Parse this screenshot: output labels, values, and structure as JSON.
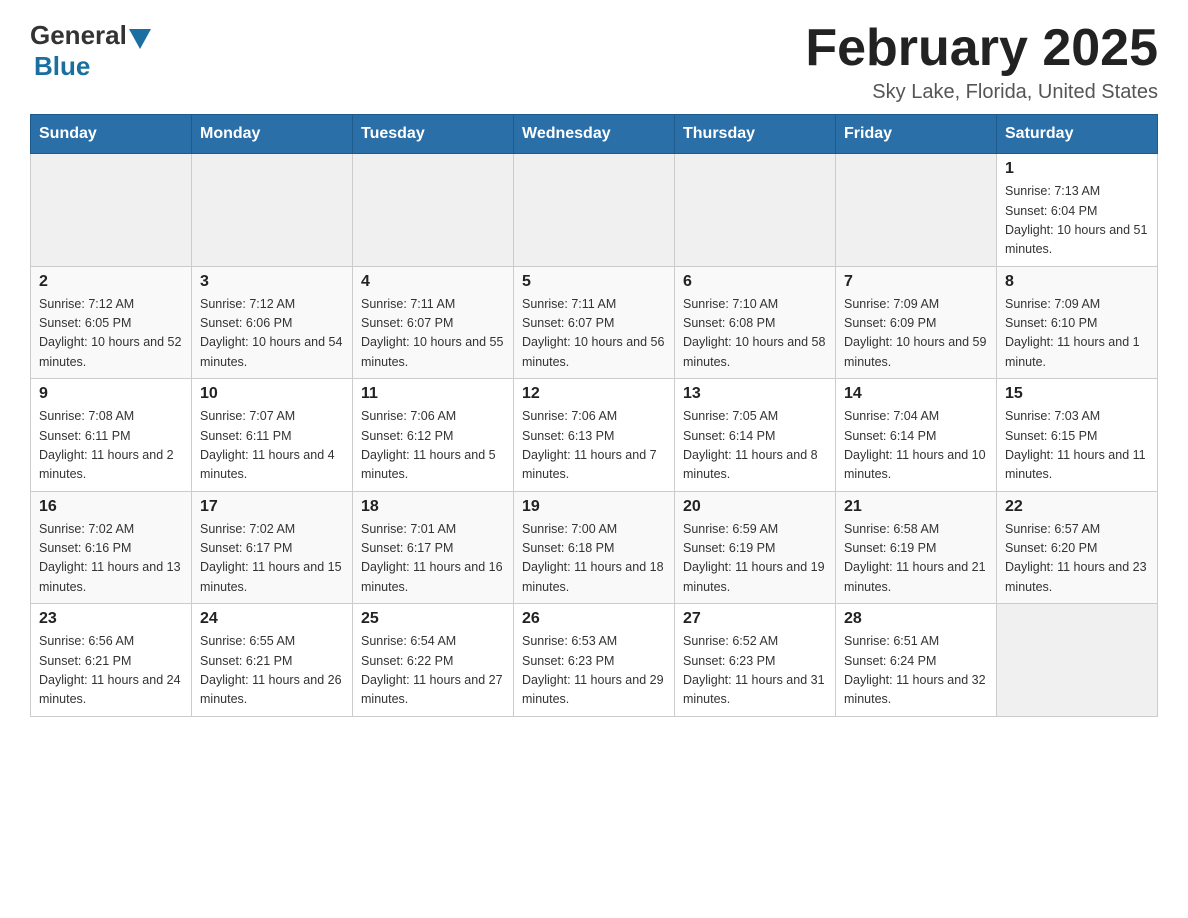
{
  "header": {
    "logo_general": "General",
    "logo_blue": "Blue",
    "title": "February 2025",
    "subtitle": "Sky Lake, Florida, United States"
  },
  "weekdays": [
    "Sunday",
    "Monday",
    "Tuesday",
    "Wednesday",
    "Thursday",
    "Friday",
    "Saturday"
  ],
  "weeks": [
    [
      {
        "day": "",
        "sunrise": "",
        "sunset": "",
        "daylight": ""
      },
      {
        "day": "",
        "sunrise": "",
        "sunset": "",
        "daylight": ""
      },
      {
        "day": "",
        "sunrise": "",
        "sunset": "",
        "daylight": ""
      },
      {
        "day": "",
        "sunrise": "",
        "sunset": "",
        "daylight": ""
      },
      {
        "day": "",
        "sunrise": "",
        "sunset": "",
        "daylight": ""
      },
      {
        "day": "",
        "sunrise": "",
        "sunset": "",
        "daylight": ""
      },
      {
        "day": "1",
        "sunrise": "Sunrise: 7:13 AM",
        "sunset": "Sunset: 6:04 PM",
        "daylight": "Daylight: 10 hours and 51 minutes."
      }
    ],
    [
      {
        "day": "2",
        "sunrise": "Sunrise: 7:12 AM",
        "sunset": "Sunset: 6:05 PM",
        "daylight": "Daylight: 10 hours and 52 minutes."
      },
      {
        "day": "3",
        "sunrise": "Sunrise: 7:12 AM",
        "sunset": "Sunset: 6:06 PM",
        "daylight": "Daylight: 10 hours and 54 minutes."
      },
      {
        "day": "4",
        "sunrise": "Sunrise: 7:11 AM",
        "sunset": "Sunset: 6:07 PM",
        "daylight": "Daylight: 10 hours and 55 minutes."
      },
      {
        "day": "5",
        "sunrise": "Sunrise: 7:11 AM",
        "sunset": "Sunset: 6:07 PM",
        "daylight": "Daylight: 10 hours and 56 minutes."
      },
      {
        "day": "6",
        "sunrise": "Sunrise: 7:10 AM",
        "sunset": "Sunset: 6:08 PM",
        "daylight": "Daylight: 10 hours and 58 minutes."
      },
      {
        "day": "7",
        "sunrise": "Sunrise: 7:09 AM",
        "sunset": "Sunset: 6:09 PM",
        "daylight": "Daylight: 10 hours and 59 minutes."
      },
      {
        "day": "8",
        "sunrise": "Sunrise: 7:09 AM",
        "sunset": "Sunset: 6:10 PM",
        "daylight": "Daylight: 11 hours and 1 minute."
      }
    ],
    [
      {
        "day": "9",
        "sunrise": "Sunrise: 7:08 AM",
        "sunset": "Sunset: 6:11 PM",
        "daylight": "Daylight: 11 hours and 2 minutes."
      },
      {
        "day": "10",
        "sunrise": "Sunrise: 7:07 AM",
        "sunset": "Sunset: 6:11 PM",
        "daylight": "Daylight: 11 hours and 4 minutes."
      },
      {
        "day": "11",
        "sunrise": "Sunrise: 7:06 AM",
        "sunset": "Sunset: 6:12 PM",
        "daylight": "Daylight: 11 hours and 5 minutes."
      },
      {
        "day": "12",
        "sunrise": "Sunrise: 7:06 AM",
        "sunset": "Sunset: 6:13 PM",
        "daylight": "Daylight: 11 hours and 7 minutes."
      },
      {
        "day": "13",
        "sunrise": "Sunrise: 7:05 AM",
        "sunset": "Sunset: 6:14 PM",
        "daylight": "Daylight: 11 hours and 8 minutes."
      },
      {
        "day": "14",
        "sunrise": "Sunrise: 7:04 AM",
        "sunset": "Sunset: 6:14 PM",
        "daylight": "Daylight: 11 hours and 10 minutes."
      },
      {
        "day": "15",
        "sunrise": "Sunrise: 7:03 AM",
        "sunset": "Sunset: 6:15 PM",
        "daylight": "Daylight: 11 hours and 11 minutes."
      }
    ],
    [
      {
        "day": "16",
        "sunrise": "Sunrise: 7:02 AM",
        "sunset": "Sunset: 6:16 PM",
        "daylight": "Daylight: 11 hours and 13 minutes."
      },
      {
        "day": "17",
        "sunrise": "Sunrise: 7:02 AM",
        "sunset": "Sunset: 6:17 PM",
        "daylight": "Daylight: 11 hours and 15 minutes."
      },
      {
        "day": "18",
        "sunrise": "Sunrise: 7:01 AM",
        "sunset": "Sunset: 6:17 PM",
        "daylight": "Daylight: 11 hours and 16 minutes."
      },
      {
        "day": "19",
        "sunrise": "Sunrise: 7:00 AM",
        "sunset": "Sunset: 6:18 PM",
        "daylight": "Daylight: 11 hours and 18 minutes."
      },
      {
        "day": "20",
        "sunrise": "Sunrise: 6:59 AM",
        "sunset": "Sunset: 6:19 PM",
        "daylight": "Daylight: 11 hours and 19 minutes."
      },
      {
        "day": "21",
        "sunrise": "Sunrise: 6:58 AM",
        "sunset": "Sunset: 6:19 PM",
        "daylight": "Daylight: 11 hours and 21 minutes."
      },
      {
        "day": "22",
        "sunrise": "Sunrise: 6:57 AM",
        "sunset": "Sunset: 6:20 PM",
        "daylight": "Daylight: 11 hours and 23 minutes."
      }
    ],
    [
      {
        "day": "23",
        "sunrise": "Sunrise: 6:56 AM",
        "sunset": "Sunset: 6:21 PM",
        "daylight": "Daylight: 11 hours and 24 minutes."
      },
      {
        "day": "24",
        "sunrise": "Sunrise: 6:55 AM",
        "sunset": "Sunset: 6:21 PM",
        "daylight": "Daylight: 11 hours and 26 minutes."
      },
      {
        "day": "25",
        "sunrise": "Sunrise: 6:54 AM",
        "sunset": "Sunset: 6:22 PM",
        "daylight": "Daylight: 11 hours and 27 minutes."
      },
      {
        "day": "26",
        "sunrise": "Sunrise: 6:53 AM",
        "sunset": "Sunset: 6:23 PM",
        "daylight": "Daylight: 11 hours and 29 minutes."
      },
      {
        "day": "27",
        "sunrise": "Sunrise: 6:52 AM",
        "sunset": "Sunset: 6:23 PM",
        "daylight": "Daylight: 11 hours and 31 minutes."
      },
      {
        "day": "28",
        "sunrise": "Sunrise: 6:51 AM",
        "sunset": "Sunset: 6:24 PM",
        "daylight": "Daylight: 11 hours and 32 minutes."
      },
      {
        "day": "",
        "sunrise": "",
        "sunset": "",
        "daylight": ""
      }
    ]
  ]
}
